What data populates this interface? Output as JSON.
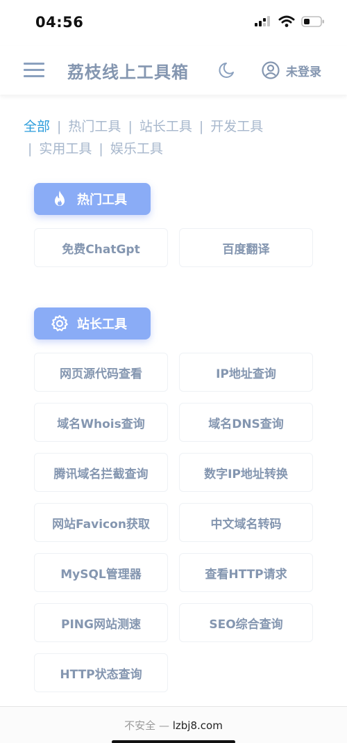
{
  "status_bar": {
    "time": "04:56",
    "icons": [
      "signal-icon",
      "wifi-icon",
      "battery-icon"
    ]
  },
  "header": {
    "title": "荔枝线上工具箱",
    "login_label": "未登录",
    "icons": [
      "menu-icon",
      "moon-icon",
      "user-icon"
    ]
  },
  "categories": {
    "all": "全部",
    "hot": "热门工具",
    "webmaster": "站长工具",
    "dev": "开发工具",
    "utility": "实用工具",
    "fun": "娱乐工具",
    "separator": "|"
  },
  "sections": {
    "hot": {
      "title": "热门工具",
      "icon": "flame-icon",
      "tools": [
        "免费ChatGpt",
        "百度翻译"
      ]
    },
    "webmaster": {
      "title": "站长工具",
      "icon": "gear-icon",
      "tools": [
        "网页源代码查看",
        "IP地址查询",
        "域名Whois查询",
        "域名DNS查询",
        "腾讯域名拦截查询",
        "数字IP地址转换",
        "网站Favicon获取",
        "中文域名转码",
        "MySQL管理器",
        "查看HTTP请求",
        "PING网站测速",
        "SEO综合查询",
        "HTTP状态查询"
      ]
    }
  },
  "browser": {
    "insecure_label": "不安全 —",
    "domain": "lzbj8.com"
  },
  "colors": {
    "accent": "#2b9cdb",
    "section_header_bg": "#8aacf6",
    "text_muted": "#8496b0",
    "nav_text": "#a7b7cc"
  }
}
